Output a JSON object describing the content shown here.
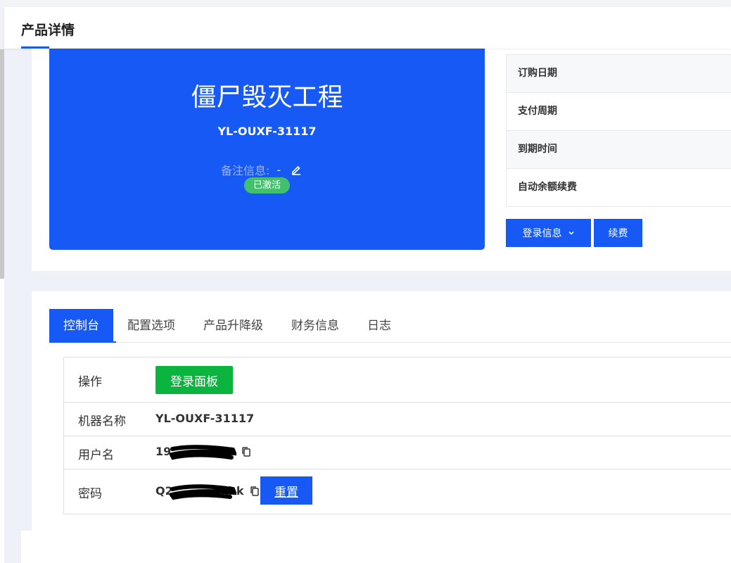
{
  "header": {
    "title": "产品详情"
  },
  "product": {
    "name": "僵尸毁灭工程",
    "code": "YL-OUXF-31117",
    "remark_label": "备注信息:",
    "remark_value": "-",
    "status": "已激活"
  },
  "info_rows": [
    "订购日期",
    "支付周期",
    "到期时间",
    "自动余额续费"
  ],
  "actions": {
    "login_info": "登录信息",
    "renew": "续费"
  },
  "tabs": [
    "控制台",
    "配置选项",
    "产品升降级",
    "财务信息",
    "日志"
  ],
  "details": {
    "operation_label": "操作",
    "login_panel": "登录面板",
    "machine_name_label": "机器名称",
    "machine_name": "YL-OUXF-31117",
    "username_label": "用户名",
    "username_prefix": "19",
    "username_suffix": "39",
    "password_label": "密码",
    "password_prefix": "Q2",
    "password_suffix": "kbk",
    "reset": "重置"
  },
  "colors": {
    "primary": "#1659f5",
    "success": "#0bb33f",
    "status_badge": "#43c06c"
  },
  "icons": [
    "edit-icon",
    "chevron-down-icon",
    "copy-icon"
  ]
}
